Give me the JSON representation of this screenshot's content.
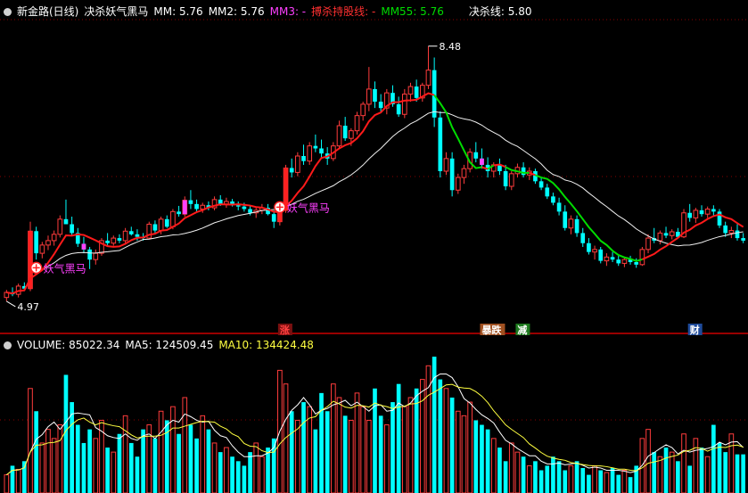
{
  "header": {
    "title": "新金路(日线)",
    "indicator_name": "决杀妖气黑马",
    "mm": "MM: 5.76",
    "mm2": "MM2: 5.76",
    "mm3": "MM3: -",
    "hold": "搏杀持股线: -",
    "mm55": "MM55: 5.76",
    "kill_line": "决杀线: 5.80"
  },
  "volume_header": {
    "volume": "VOLUME: 85022.34",
    "ma5": "MA5: 124509.45",
    "ma10": "MA10: 134424.48"
  },
  "signals": [
    {
      "text": "妖气黑马",
      "at_index": 5,
      "price": 4.97
    },
    {
      "text": "妖气黑马",
      "at_index": 46,
      "price": 5.93
    }
  ],
  "bottom_tags": [
    {
      "text": "涨",
      "color": "#ff4040",
      "bg": "#7a1010",
      "at_index": 46
    },
    {
      "text": "暴跌",
      "color": "#ffffff",
      "bg": "#a05020",
      "at_index": 80
    },
    {
      "text": "减",
      "color": "#ffffff",
      "bg": "#1e7a1e",
      "at_index": 86
    },
    {
      "text": "财",
      "color": "#ffffff",
      "bg": "#1e4a9a",
      "at_index": 115
    }
  ],
  "colors": {
    "up": "#ff3c3c",
    "down": "#00ffff",
    "mm_line": "#ff1a1a",
    "mm55_green": "#00dd00",
    "slow_line": "#f0f0f0",
    "vol_ma5": "#ffffff",
    "vol_ma10": "#ffff40",
    "grid": "#8a0000",
    "mm3": "#ff40ff",
    "hold": "#ff3030"
  },
  "chart_data": {
    "type": "candlestick",
    "price_high_label": "8.48",
    "price_low_label": "4.97",
    "ylim": [
      4.1,
      8.9
    ],
    "volume_ylim": [
      0,
      310000
    ],
    "ohlc": [
      [
        4.5,
        4.62,
        4.44,
        4.58
      ],
      [
        4.58,
        4.66,
        4.52,
        4.55
      ],
      [
        4.55,
        4.72,
        4.5,
        4.68
      ],
      [
        4.68,
        4.74,
        4.6,
        4.64
      ],
      [
        4.64,
        5.7,
        4.6,
        5.55
      ],
      [
        5.55,
        5.62,
        5.1,
        5.2
      ],
      [
        5.2,
        5.38,
        5.12,
        5.33
      ],
      [
        5.33,
        5.48,
        5.25,
        5.4
      ],
      [
        5.4,
        5.56,
        5.32,
        5.5
      ],
      [
        5.5,
        5.8,
        5.45,
        5.74
      ],
      [
        5.74,
        6.05,
        5.66,
        5.66
      ],
      [
        5.66,
        5.78,
        5.48,
        5.52
      ],
      [
        5.52,
        5.6,
        5.3,
        5.35
      ],
      [
        5.35,
        5.46,
        5.2,
        5.26
      ],
      [
        5.26,
        5.3,
        4.95,
        5.1
      ],
      [
        5.1,
        5.26,
        5.02,
        5.2
      ],
      [
        5.2,
        5.44,
        5.16,
        5.4
      ],
      [
        5.4,
        5.52,
        5.3,
        5.36
      ],
      [
        5.36,
        5.48,
        5.32,
        5.44
      ],
      [
        5.44,
        5.5,
        5.36,
        5.4
      ],
      [
        5.4,
        5.6,
        5.36,
        5.55
      ],
      [
        5.55,
        5.62,
        5.48,
        5.5
      ],
      [
        5.5,
        5.58,
        5.4,
        5.46
      ],
      [
        5.46,
        5.52,
        5.4,
        5.44
      ],
      [
        5.44,
        5.7,
        5.42,
        5.66
      ],
      [
        5.66,
        5.72,
        5.52,
        5.56
      ],
      [
        5.56,
        5.78,
        5.5,
        5.74
      ],
      [
        5.74,
        5.8,
        5.6,
        5.62
      ],
      [
        5.62,
        5.9,
        5.58,
        5.86
      ],
      [
        5.86,
        5.95,
        5.78,
        5.82
      ],
      [
        5.82,
        6.1,
        5.78,
        6.04
      ],
      [
        6.04,
        6.2,
        5.9,
        5.98
      ],
      [
        5.98,
        6.05,
        5.86,
        5.9
      ],
      [
        5.9,
        6.0,
        5.84,
        5.96
      ],
      [
        5.96,
        6.02,
        5.88,
        5.92
      ],
      [
        5.92,
        6.1,
        5.88,
        6.05
      ],
      [
        6.05,
        6.12,
        5.95,
        5.98
      ],
      [
        5.98,
        6.08,
        5.92,
        6.02
      ],
      [
        6.02,
        6.06,
        5.94,
        5.96
      ],
      [
        5.96,
        6.02,
        5.88,
        5.94
      ],
      [
        5.94,
        6.0,
        5.86,
        5.9
      ],
      [
        5.9,
        5.96,
        5.8,
        5.84
      ],
      [
        5.84,
        5.92,
        5.76,
        5.88
      ],
      [
        5.88,
        5.98,
        5.82,
        5.92
      ],
      [
        5.92,
        5.98,
        5.8,
        5.82
      ],
      [
        5.82,
        5.88,
        5.6,
        5.7
      ],
      [
        5.7,
        5.92,
        5.64,
        5.88
      ],
      [
        5.88,
        6.6,
        5.84,
        6.55
      ],
      [
        6.55,
        6.7,
        6.4,
        6.48
      ],
      [
        6.48,
        6.8,
        6.42,
        6.74
      ],
      [
        6.74,
        6.92,
        6.6,
        6.66
      ],
      [
        6.66,
        6.96,
        6.6,
        6.9
      ],
      [
        6.9,
        7.08,
        6.8,
        6.86
      ],
      [
        6.86,
        7.0,
        6.7,
        6.78
      ],
      [
        6.78,
        6.88,
        6.6,
        6.7
      ],
      [
        6.7,
        6.96,
        6.66,
        6.9
      ],
      [
        6.9,
        7.3,
        6.86,
        7.22
      ],
      [
        7.22,
        7.36,
        6.98,
        7.02
      ],
      [
        7.02,
        7.18,
        6.9,
        7.14
      ],
      [
        7.14,
        7.44,
        7.08,
        7.38
      ],
      [
        7.38,
        7.6,
        7.3,
        7.56
      ],
      [
        7.56,
        8.15,
        7.45,
        7.8
      ],
      [
        7.8,
        7.92,
        7.5,
        7.6
      ],
      [
        7.6,
        7.72,
        7.42,
        7.5
      ],
      [
        7.5,
        7.8,
        7.4,
        7.74
      ],
      [
        7.74,
        7.86,
        7.52,
        7.56
      ],
      [
        7.56,
        7.68,
        7.36,
        7.4
      ],
      [
        7.4,
        7.8,
        7.34,
        7.72
      ],
      [
        7.72,
        7.9,
        7.6,
        7.84
      ],
      [
        7.84,
        7.95,
        7.6,
        7.66
      ],
      [
        7.66,
        7.9,
        7.6,
        7.86
      ],
      [
        7.86,
        8.48,
        7.8,
        8.1
      ],
      [
        8.1,
        8.3,
        7.2,
        7.35
      ],
      [
        7.35,
        7.45,
        6.4,
        6.5
      ],
      [
        6.5,
        6.8,
        6.44,
        6.7
      ],
      [
        6.7,
        6.8,
        6.1,
        6.2
      ],
      [
        6.2,
        6.46,
        6.14,
        6.4
      ],
      [
        6.4,
        6.6,
        6.3,
        6.54
      ],
      [
        6.54,
        6.86,
        6.48,
        6.8
      ],
      [
        6.8,
        6.96,
        6.64,
        6.7
      ],
      [
        6.7,
        6.86,
        6.54,
        6.6
      ],
      [
        6.6,
        6.72,
        6.4,
        6.5
      ],
      [
        6.5,
        6.64,
        6.4,
        6.6
      ],
      [
        6.6,
        6.7,
        6.44,
        6.5
      ],
      [
        6.5,
        6.6,
        6.2,
        6.26
      ],
      [
        6.26,
        6.5,
        6.2,
        6.46
      ],
      [
        6.46,
        6.62,
        6.4,
        6.56
      ],
      [
        6.56,
        6.64,
        6.4,
        6.44
      ],
      [
        6.44,
        6.56,
        6.36,
        6.5
      ],
      [
        6.5,
        6.54,
        6.3,
        6.34
      ],
      [
        6.34,
        6.4,
        6.2,
        6.24
      ],
      [
        6.24,
        6.3,
        6.06,
        6.1
      ],
      [
        6.1,
        6.16,
        5.96,
        6.0
      ],
      [
        6.0,
        6.08,
        5.8,
        5.86
      ],
      [
        5.86,
        5.96,
        5.56,
        5.6
      ],
      [
        5.6,
        5.8,
        5.5,
        5.74
      ],
      [
        5.74,
        5.8,
        5.46,
        5.52
      ],
      [
        5.52,
        5.6,
        5.3,
        5.36
      ],
      [
        5.36,
        5.44,
        5.18,
        5.22
      ],
      [
        5.22,
        5.32,
        5.1,
        5.26
      ],
      [
        5.26,
        5.3,
        5.04,
        5.08
      ],
      [
        5.08,
        5.2,
        5.0,
        5.14
      ],
      [
        5.14,
        5.22,
        5.06,
        5.1
      ],
      [
        5.1,
        5.16,
        5.0,
        5.04
      ],
      [
        5.04,
        5.14,
        4.98,
        5.1
      ],
      [
        5.1,
        5.16,
        5.02,
        5.06
      ],
      [
        5.06,
        5.12,
        4.97,
        5.02
      ],
      [
        5.02,
        5.3,
        5.0,
        5.26
      ],
      [
        5.26,
        5.5,
        5.2,
        5.44
      ],
      [
        5.44,
        5.6,
        5.36,
        5.4
      ],
      [
        5.4,
        5.56,
        5.34,
        5.52
      ],
      [
        5.52,
        5.62,
        5.44,
        5.48
      ],
      [
        5.48,
        5.58,
        5.42,
        5.54
      ],
      [
        5.54,
        5.6,
        5.44,
        5.46
      ],
      [
        5.46,
        5.9,
        5.44,
        5.84
      ],
      [
        5.84,
        5.98,
        5.7,
        5.76
      ],
      [
        5.76,
        5.92,
        5.68,
        5.88
      ],
      [
        5.88,
        5.96,
        5.78,
        5.82
      ],
      [
        5.82,
        5.94,
        5.76,
        5.9
      ],
      [
        5.9,
        5.96,
        5.8,
        5.86
      ],
      [
        5.86,
        5.9,
        5.6,
        5.64
      ],
      [
        5.64,
        5.7,
        5.46,
        5.52
      ],
      [
        5.52,
        5.62,
        5.44,
        5.56
      ],
      [
        5.56,
        5.66,
        5.4,
        5.44
      ],
      [
        5.44,
        5.52,
        5.36,
        5.4
      ]
    ],
    "volume": [
      40000,
      60000,
      52000,
      70000,
      230000,
      180000,
      110000,
      140000,
      120000,
      150000,
      260000,
      200000,
      150000,
      110000,
      140000,
      120000,
      160000,
      100000,
      90000,
      130000,
      170000,
      110000,
      80000,
      140000,
      150000,
      120000,
      180000,
      160000,
      190000,
      130000,
      210000,
      150000,
      120000,
      170000,
      140000,
      110000,
      90000,
      100000,
      80000,
      70000,
      60000,
      90000,
      110000,
      80000,
      100000,
      120000,
      270000,
      240000,
      180000,
      160000,
      200000,
      190000,
      140000,
      220000,
      180000,
      240000,
      210000,
      170000,
      160000,
      220000,
      190000,
      160000,
      230000,
      170000,
      150000,
      200000,
      240000,
      190000,
      210000,
      230000,
      250000,
      280000,
      300000,
      250000,
      230000,
      210000,
      180000,
      170000,
      200000,
      160000,
      150000,
      140000,
      120000,
      100000,
      70000,
      110000,
      90000,
      80000,
      60000,
      70000,
      50000,
      60000,
      80000,
      70000,
      50000,
      60000,
      70000,
      55000,
      40000,
      60000,
      50000,
      45000,
      55000,
      40000,
      50000,
      35000,
      60000,
      120000,
      140000,
      90000,
      80000,
      100000,
      90000,
      70000,
      130000,
      60000,
      120000,
      100000,
      80000,
      150000,
      110000,
      90000,
      130000,
      85000,
      85022
    ]
  }
}
